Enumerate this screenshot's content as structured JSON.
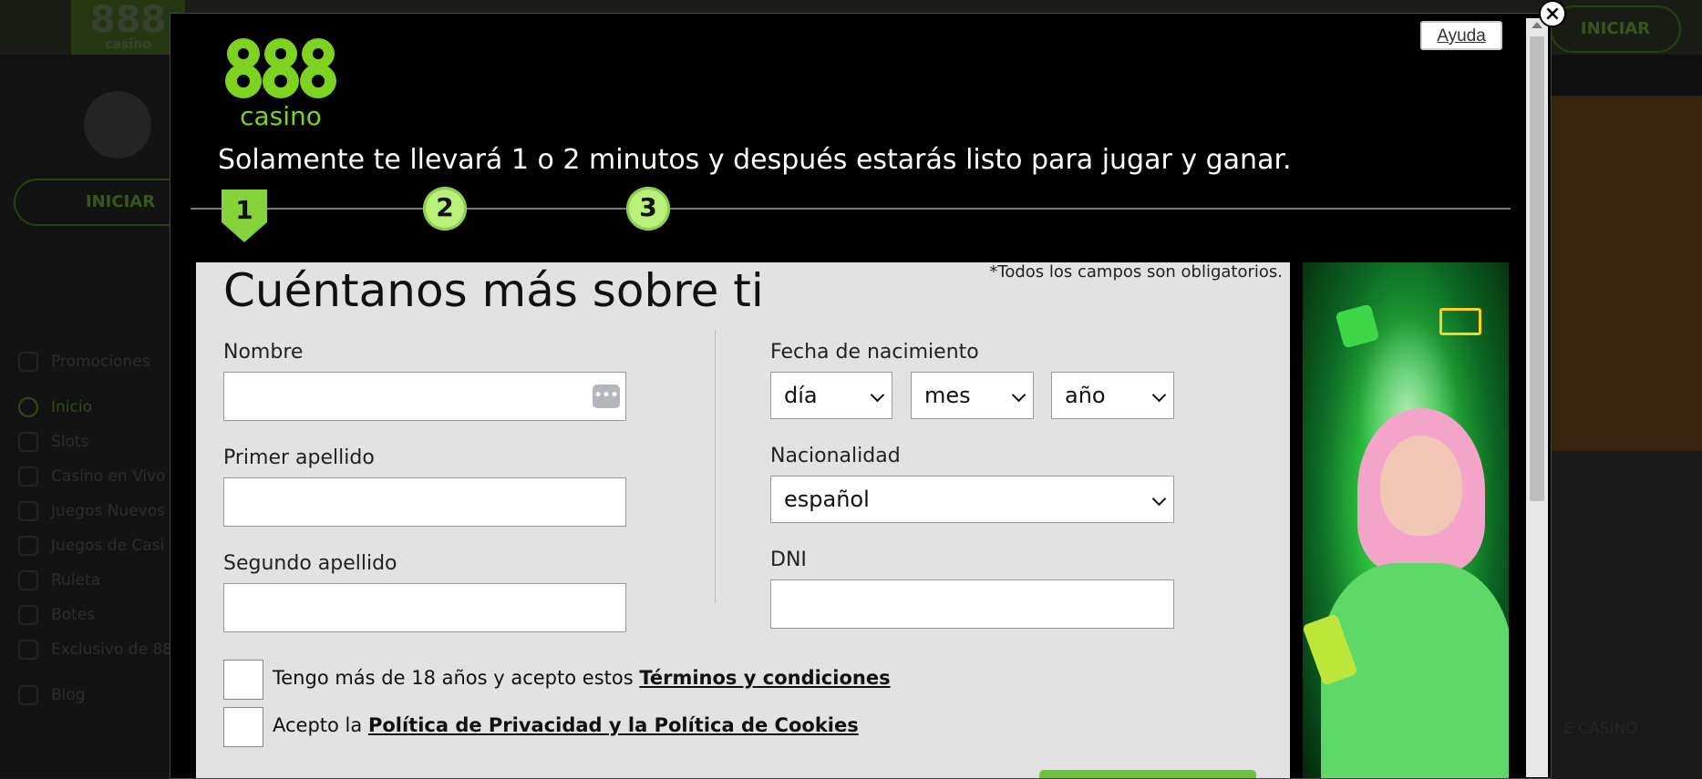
{
  "background": {
    "logo_text": "888",
    "logo_sub": "casino",
    "login_button": "INICIAR",
    "top_login_button": "INICIAR",
    "nav_items": [
      {
        "label": "Promociones",
        "active": false
      },
      {
        "label": "Inicio",
        "active": true
      },
      {
        "label": "Slots",
        "active": false
      },
      {
        "label": "Casino en Vivo",
        "active": false
      },
      {
        "label": "Juegos Nuevos",
        "active": false
      },
      {
        "label": "Juegos de Casi",
        "active": false
      },
      {
        "label": "Ruleta",
        "active": false
      },
      {
        "label": "Botes",
        "active": false
      },
      {
        "label": "Exclusivo de 88",
        "active": false
      },
      {
        "label": "Blog",
        "active": false
      }
    ],
    "right_label": "E CASINO"
  },
  "modal": {
    "logo_text": "888",
    "logo_sub": "casino",
    "help_button": "Ayuda",
    "close_glyph": "×",
    "tagline": "Solamente te llevará 1 o 2 minutos y después estarás listo para jugar y ganar.",
    "steps": [
      "1",
      "2",
      "3"
    ],
    "active_step": 1,
    "brand_green": "#86d23a"
  },
  "form": {
    "title": "Cuéntanos más sobre ti",
    "required_note": "*Todos los campos son obligatorios.",
    "first_name": {
      "label": "Nombre",
      "value": "",
      "placeholder": ""
    },
    "first_surname": {
      "label": "Primer apellido",
      "value": "",
      "placeholder": ""
    },
    "second_surname": {
      "label": "Segundo apellido",
      "value": "",
      "placeholder": ""
    },
    "birth_date": {
      "label": "Fecha de nacimiento",
      "day": "día",
      "month": "mes",
      "year": "año"
    },
    "nationality": {
      "label": "Nacionalidad",
      "value": "español"
    },
    "dni": {
      "label": "DNI",
      "value": "",
      "placeholder": ""
    },
    "terms": {
      "prefix": "Tengo más de 18 años y acepto estos ",
      "link": "Términos y condiciones",
      "checked": false
    },
    "privacy": {
      "prefix": "Acepto la ",
      "link": "Política de Privacidad y la Política de Cookies",
      "checked": false
    }
  }
}
